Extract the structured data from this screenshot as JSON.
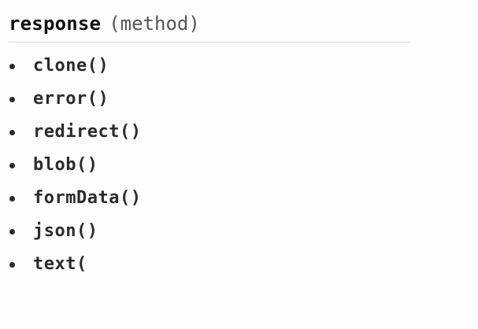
{
  "header": {
    "title": "response",
    "kind": "(method)"
  },
  "methods": [
    {
      "label": "clone()"
    },
    {
      "label": "error()"
    },
    {
      "label": "redirect()"
    },
    {
      "label": "blob()"
    },
    {
      "label": "formData()"
    },
    {
      "label": "json()"
    },
    {
      "label": "text("
    }
  ]
}
